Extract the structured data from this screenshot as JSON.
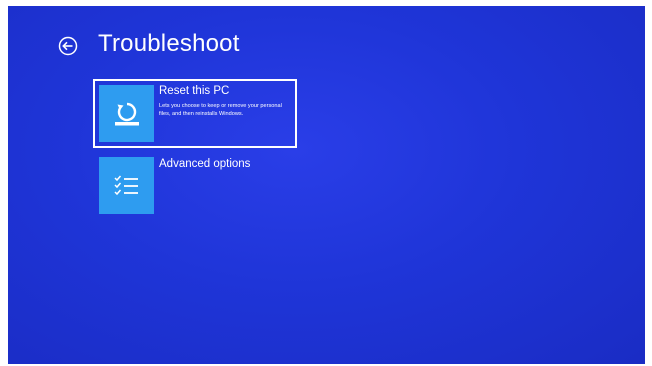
{
  "page": {
    "title": "Troubleshoot"
  },
  "options": [
    {
      "label": "Reset this PC",
      "description": "Lets you choose to keep or remove your personal files, and then reinstalls Windows.",
      "icon": "reset-pc-icon",
      "selected": true
    },
    {
      "label": "Advanced options",
      "description": "",
      "icon": "checklist-icon",
      "selected": false
    }
  ],
  "colors": {
    "background": "#1f35d8",
    "tile": "#2e9cf0",
    "text": "#ffffff"
  }
}
